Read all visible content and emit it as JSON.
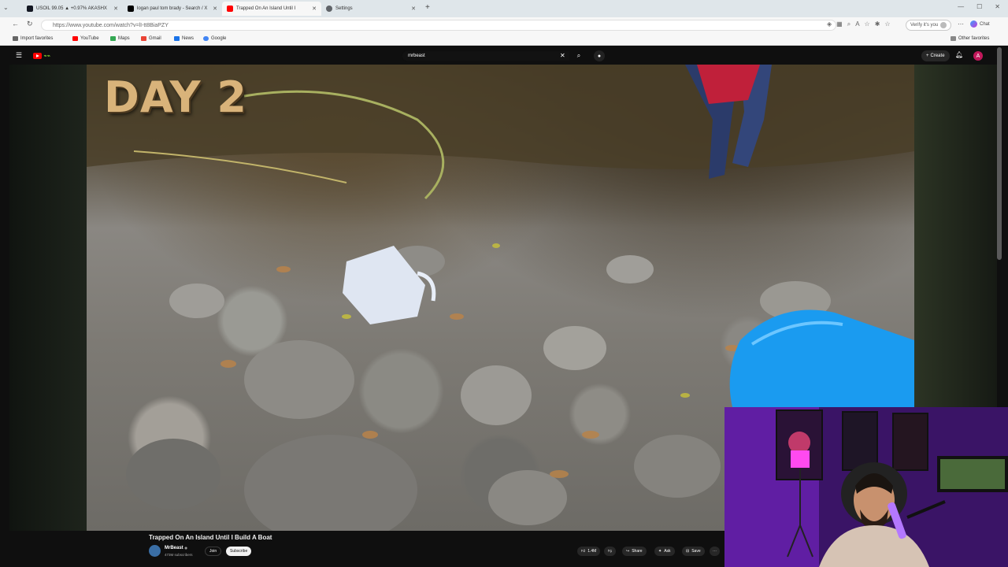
{
  "browser": {
    "tabs": [
      {
        "label": "USOIL 99.05 ▲ +0.97% AKASHX",
        "fav_color": "#131722",
        "active": false
      },
      {
        "label": "logan paul tom brady - Search / X",
        "fav_color": "#000000",
        "active": false
      },
      {
        "label": "Trapped On An Island Until I",
        "fav_color": "#ff0000",
        "active": true
      },
      {
        "label": "Settings",
        "fav_color": "#5f6368",
        "active": false
      }
    ],
    "url": "https://www.youtube.com/watch?v=lI-tt8BiaPZY",
    "verify_label": "Verify it's you",
    "copilot_label": "Chat",
    "favorites": [
      {
        "label": "Import favorites",
        "color": "#666666"
      },
      {
        "label": "YouTube",
        "color": "#ff0000"
      },
      {
        "label": "Maps",
        "color": "#34a853"
      },
      {
        "label": "Gmail",
        "color": "#ea4335"
      },
      {
        "label": "News",
        "color": "#1a73e8"
      },
      {
        "label": "Google",
        "color": "#4285f4"
      }
    ],
    "other_favorites": "Other favorites"
  },
  "youtube": {
    "search_value": "mrbeast",
    "create_label": "Create",
    "avatar_letter": "A",
    "video": {
      "overlay_text": "DAY 2"
    },
    "video_title": "Trapped On An Island Until I Build A Boat",
    "channel": {
      "name": "MrBeast",
      "verified_mark": "◉",
      "subscribers": "473M subscribers"
    },
    "join_label": "Join",
    "subscribe_label": "Subscribe",
    "actions": {
      "like_count": "1.4M",
      "share_label": "Share",
      "ask_label": "Ask",
      "save_label": "Save"
    }
  },
  "icons": {
    "menu": "hamburger-icon",
    "search": "search-icon",
    "mic": "mic-icon",
    "bell": "bell-icon",
    "like": "thumbs-up-icon",
    "dislike": "thumbs-down-icon",
    "share": "share-icon",
    "ask": "sparkle-icon",
    "save": "bookmark-icon",
    "more": "more-icon"
  }
}
